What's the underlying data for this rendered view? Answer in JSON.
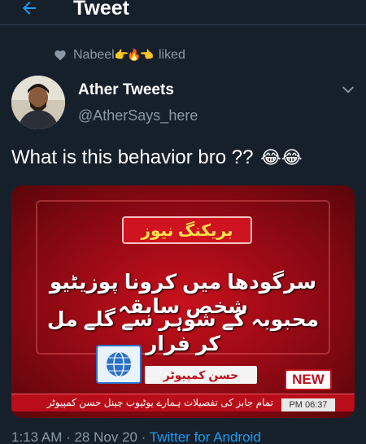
{
  "header": {
    "title": "Tweet",
    "back_icon": "arrow-left-icon"
  },
  "social_context": {
    "user": "Nabeel",
    "emojis": "👉🔥👈",
    "action": "liked",
    "icon": "heart-icon"
  },
  "author": {
    "name": "Ather Tweets",
    "handle": "@AtherSays_here",
    "menu_icon": "chevron-down-icon"
  },
  "tweet": {
    "text": "What is this behavior bro ??",
    "emojis": "😂😂"
  },
  "media": {
    "headline": "بریکنگ نیوز",
    "line1": "سرگودھا میں کرونا پوزیٹیو شخص سابقہ",
    "line2": "محبوبہ کے شوہر سے گلے مل کر فرار",
    "brand": "حسن کمپیوٹر",
    "badge": "NEW",
    "ticker": "تمام جابز کی تفصیلات ہمارے یوٹیوب چینل حسن کمپیوٹر",
    "time": "PM 06:37"
  },
  "meta": {
    "timestamp": "1:13 AM · 28 Nov 20 · ",
    "source": "Twitter for Android"
  },
  "colors": {
    "background": "#15202b",
    "secondary_text": "#8b98a5",
    "accent": "#1d9bf0"
  }
}
